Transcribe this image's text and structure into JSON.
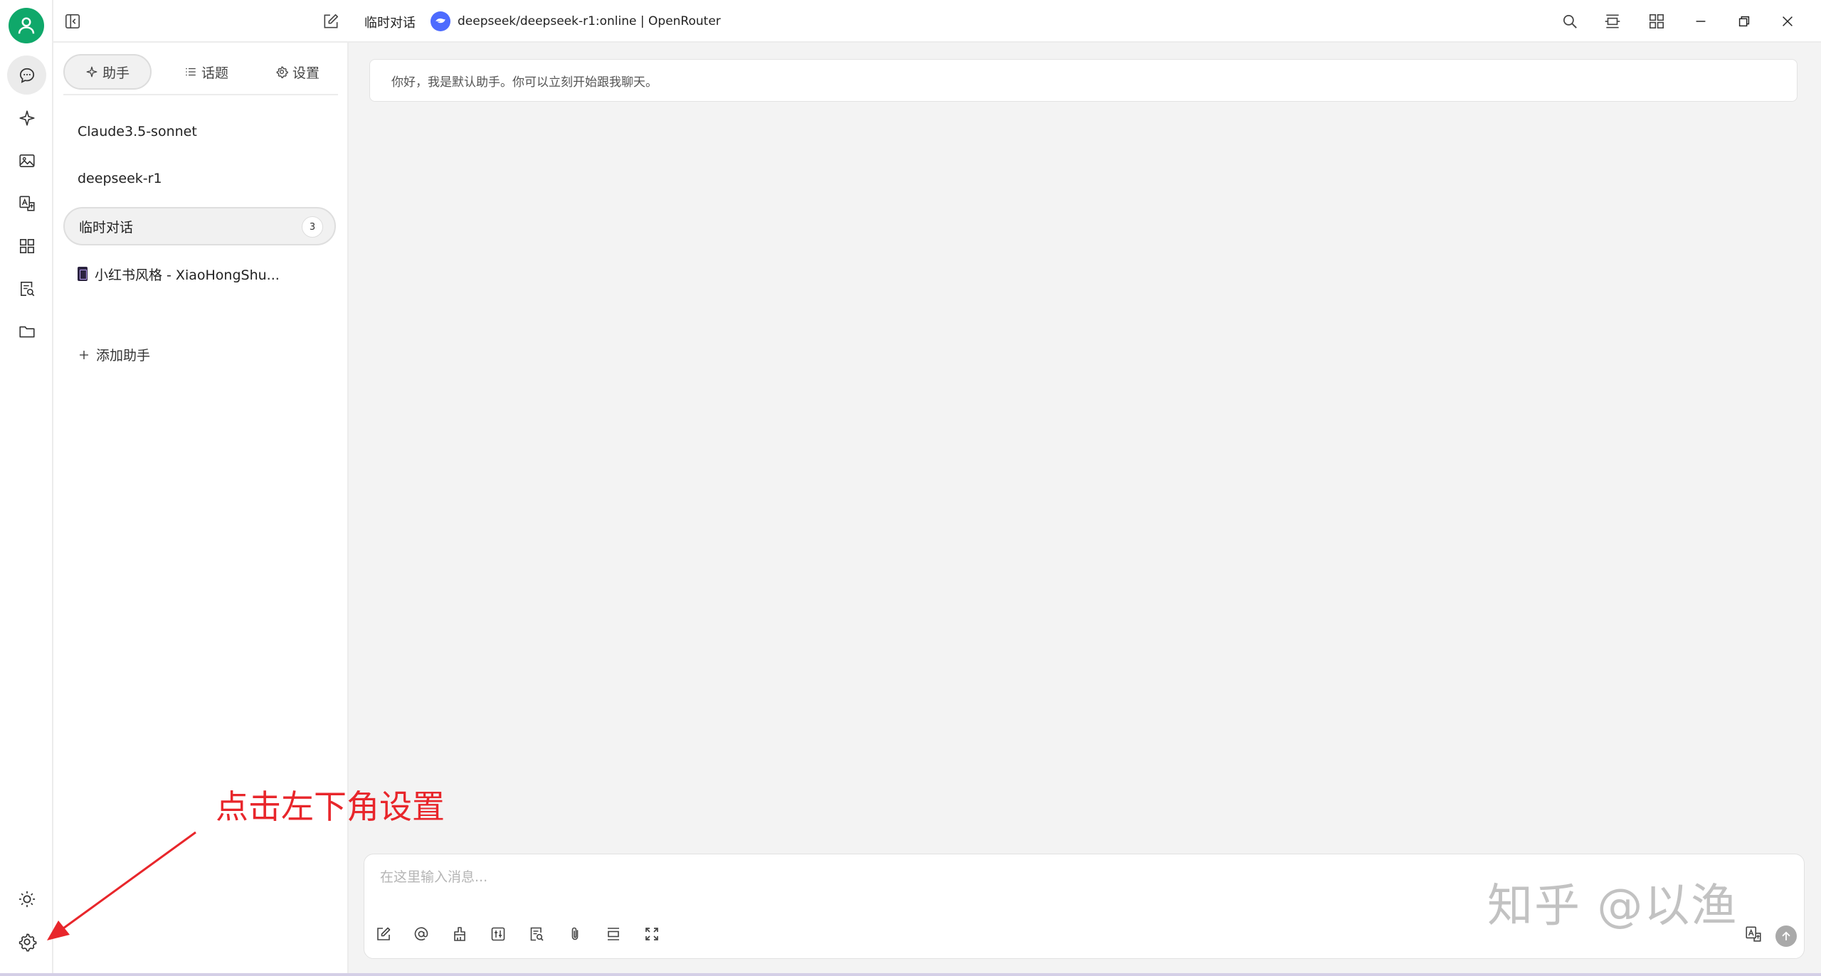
{
  "titlebar": {
    "conversation_title": "临时对话",
    "model": "deepseek/deepseek-r1:online | OpenRouter"
  },
  "panel": {
    "tabs": [
      {
        "label": "助手",
        "icon": "sparkle-icon",
        "active": true
      },
      {
        "label": "话题",
        "icon": "list-icon",
        "active": false
      },
      {
        "label": "设置",
        "icon": "gear-icon",
        "active": false
      }
    ],
    "assistants": [
      {
        "name": "Claude3.5-sonnet"
      },
      {
        "name": "deepseek-r1"
      },
      {
        "name": "临时对话",
        "count": "3",
        "selected": true
      },
      {
        "name": "小红书风格 - XiaoHongShu...",
        "emoji": "book"
      }
    ],
    "add_label": "添加助手"
  },
  "chat": {
    "greeting": "你好，我是默认助手。你可以立刻开始跟我聊天。",
    "input_placeholder": "在这里输入消息..."
  },
  "annotation": {
    "text": "点击左下角设置",
    "color": "#e8262b"
  },
  "watermark": "知乎 @以渔",
  "colors": {
    "avatar": "#0fa86a",
    "model_logo": "#4d6bfe"
  }
}
